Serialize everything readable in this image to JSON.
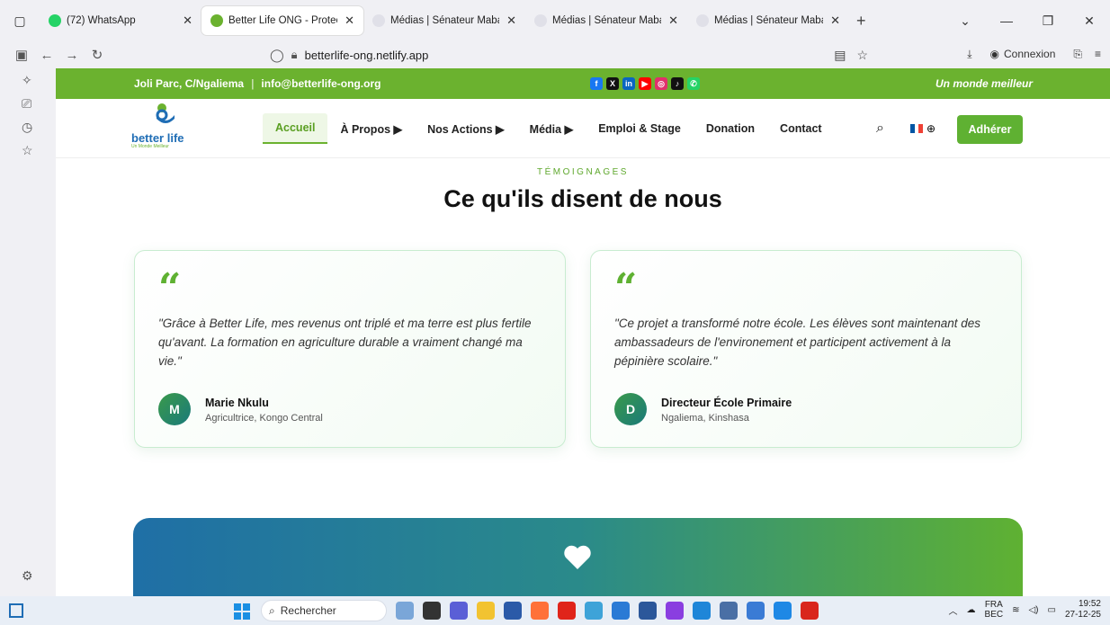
{
  "browser": {
    "tabs": [
      {
        "label": "(72) WhatsApp",
        "favicon_color": "#25d366",
        "active": false
      },
      {
        "label": "Better Life ONG - Protection de",
        "favicon_color": "#6bb22f",
        "active": true
      },
      {
        "label": "Médias | Sénateur Mabaya",
        "favicon_color": "#c9c9d1",
        "active": false
      },
      {
        "label": "Médias | Sénateur Mabaya",
        "favicon_color": "#c9c9d1",
        "active": false
      },
      {
        "label": "Médias | Sénateur Mabaya",
        "favicon_color": "#c9c9d1",
        "active": false
      }
    ],
    "url": "betterlife-ong.netlify.app",
    "connexion_label": "Connexion"
  },
  "site": {
    "topbar": {
      "address": "Joli Parc, C/Ngaliema",
      "email": "info@betterlife-ong.org",
      "slogan": "Un monde meilleur",
      "socials": [
        {
          "name": "facebook-icon",
          "color": "#1877f2",
          "glyph": "f"
        },
        {
          "name": "x-icon",
          "color": "#111111",
          "glyph": "X"
        },
        {
          "name": "linkedin-icon",
          "color": "#0a66c2",
          "glyph": "in"
        },
        {
          "name": "youtube-icon",
          "color": "#ff0000",
          "glyph": "▶"
        },
        {
          "name": "instagram-icon",
          "color": "#e1306c",
          "glyph": "◎"
        },
        {
          "name": "tiktok-icon",
          "color": "#111111",
          "glyph": "♪"
        },
        {
          "name": "whatsapp-icon",
          "color": "#25d366",
          "glyph": "✆"
        }
      ]
    },
    "logo": {
      "name": "better life",
      "tagline": "Un Monde Meilleur"
    },
    "menu": [
      {
        "label": "Accueil",
        "active": true
      },
      {
        "label": "À Propos ▶",
        "active": false
      },
      {
        "label": "Nos Actions ▶",
        "active": false
      },
      {
        "label": "Média ▶",
        "active": false
      },
      {
        "label": "Emploi & Stage",
        "active": false
      },
      {
        "label": "Donation",
        "active": false
      },
      {
        "label": "Contact",
        "active": false
      }
    ],
    "join_label": "Adhérer",
    "section": {
      "eyebrow": "TÉMOIGNAGES",
      "title": "Ce qu'ils disent de nous"
    },
    "testimonials": [
      {
        "quote": "\"Grâce à Better Life, mes revenus ont triplé et ma terre est plus fertile qu'avant. La formation en agriculture durable a vraiment changé ma vie.\"",
        "initial": "M",
        "name": "Marie Nkulu",
        "role": "Agricultrice, Kongo Central"
      },
      {
        "quote": "\"Ce projet a transformé notre école. Les élèves sont maintenant des ambassadeurs de l'environement et participent activement à la pépinière scolaire.\"",
        "initial": "D",
        "name": "Directeur École Primaire",
        "role": "Ngaliema, Kinshasa"
      }
    ],
    "colors": {
      "brand_green": "#6bb22f",
      "brand_blue": "#1f6db5"
    }
  },
  "taskbar": {
    "search_placeholder": "Rechercher",
    "lang": "FRA",
    "lang_sub": "BEC",
    "time": "19:52",
    "date": "27-12-25"
  }
}
